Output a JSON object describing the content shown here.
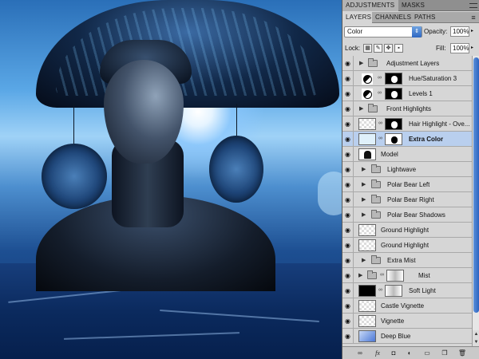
{
  "panel": {
    "top_tabs": [
      "ADJUSTMENTS",
      "MASKS"
    ],
    "sub_tabs": [
      "LAYERS",
      "CHANNELS",
      "PATHS"
    ],
    "blend_mode": "Color",
    "opacity_label": "Opacity:",
    "opacity_value": "100%",
    "lock_label": "Lock:",
    "fill_label": "Fill:",
    "fill_value": "100%"
  },
  "layers": [
    {
      "name": "Adjustment Layers",
      "kind": "group"
    },
    {
      "name": "Hue/Saturation 3",
      "kind": "adjustment"
    },
    {
      "name": "Levels 1",
      "kind": "adjustment"
    },
    {
      "name": "Front Highlights",
      "kind": "group"
    },
    {
      "name": "Hair Highlight - Ove...",
      "kind": "masked-layer"
    },
    {
      "name": "Extra Color",
      "kind": "masked-layer",
      "selected": true
    },
    {
      "name": "Model",
      "kind": "layer"
    },
    {
      "name": "Lightwave",
      "kind": "group",
      "indent": true
    },
    {
      "name": "Polar Bear Left",
      "kind": "group",
      "indent": true
    },
    {
      "name": "Polar Bear Right",
      "kind": "group",
      "indent": true
    },
    {
      "name": "Polar Bear Shadows",
      "kind": "group",
      "indent": true
    },
    {
      "name": "Ground Highlight",
      "kind": "layer"
    },
    {
      "name": "Ground Highlight",
      "kind": "layer"
    },
    {
      "name": "Extra Mist",
      "kind": "group",
      "indent": true
    },
    {
      "name": "Mist",
      "kind": "group-mask"
    },
    {
      "name": "Soft Light",
      "kind": "black-mask"
    },
    {
      "name": "Castle Vignette",
      "kind": "layer"
    },
    {
      "name": "Vignette",
      "kind": "layer"
    },
    {
      "name": "Deep Blue",
      "kind": "blue-layer"
    }
  ],
  "bottom_icons": [
    "link-icon",
    "fx-icon",
    "mask-icon",
    "adjustment-icon",
    "group-icon",
    "new-layer-icon",
    "trash-icon"
  ],
  "colors": {
    "selection": "#b9cfee",
    "scroll_thumb": "#2b63c0",
    "panel_bg": "#d6d6d6"
  }
}
